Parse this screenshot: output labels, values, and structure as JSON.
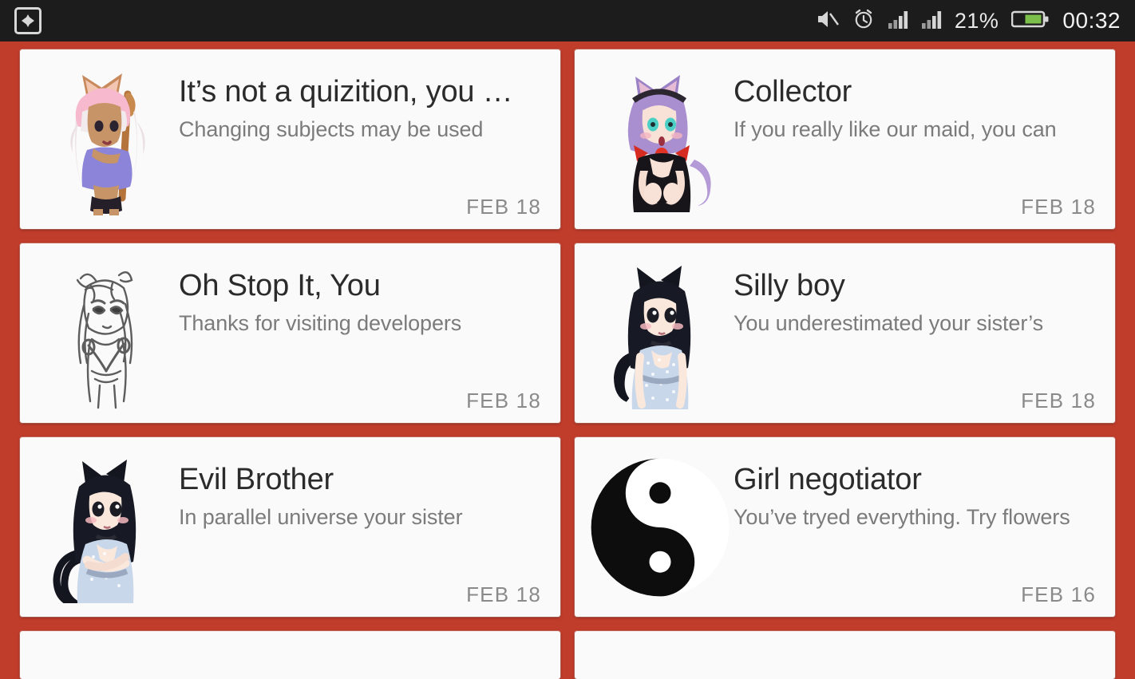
{
  "theme": {
    "background_red": "#c03c2b",
    "card_background": "#fafafa",
    "statusbar_background": "#1c1c1c",
    "title_color": "#2b2b2b",
    "subtitle_color": "#7b7b7b",
    "date_color": "#8a8a8a",
    "battery_fill": "#7cc04b"
  },
  "statusbar": {
    "left_icon": "screenshot-capture-icon",
    "icons": [
      "mute-icon",
      "alarm-clock-icon",
      "signal-bars-icon-1",
      "signal-bars-icon-2"
    ],
    "battery_percent": "21%",
    "battery_icon": "battery-icon",
    "clock": "00:32"
  },
  "cards": [
    {
      "title": "It’s not a quizition, you …",
      "subtitle": "Changing subjects may be used",
      "date": "FEB 18",
      "thumb": "catgirl-pink-hair-icon"
    },
    {
      "title": "Collector",
      "subtitle": "If you really like our maid, you can",
      "date": "FEB 18",
      "thumb": "catgirl-purple-maid-icon"
    },
    {
      "title": "Oh Stop It, You",
      "subtitle": "Thanks for visiting developers",
      "date": "FEB 18",
      "thumb": "catgirl-sketch-white-icon"
    },
    {
      "title": "Silly boy",
      "subtitle": "You underestimated your sister’s",
      "date": "FEB 18",
      "thumb": "catgirl-black-hair-dress-icon"
    },
    {
      "title": "Evil Brother",
      "subtitle": "In parallel universe your sister",
      "date": "FEB 18",
      "thumb": "catgirl-black-hair-tail-icon"
    },
    {
      "title": "Girl negotiator",
      "subtitle": "You’ve tryed everything. Try flowers",
      "date": "FEB 16",
      "thumb": "yin-yang-icon"
    }
  ]
}
